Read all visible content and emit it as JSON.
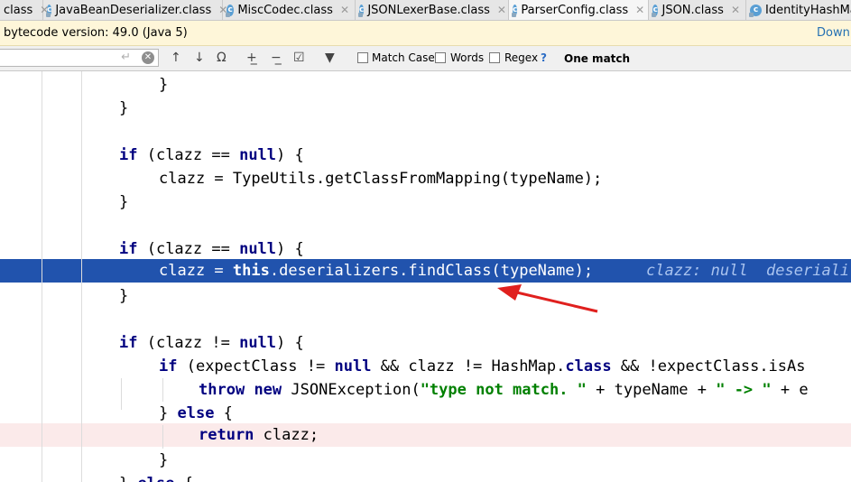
{
  "tabs": [
    {
      "label": "class",
      "active": false,
      "icon": "none"
    },
    {
      "label": "JavaBeanDeserializer.class",
      "active": false,
      "icon": "class-icon"
    },
    {
      "label": "MiscCodec.class",
      "active": false,
      "icon": "class-icon"
    },
    {
      "label": "JSONLexerBase.class",
      "active": false,
      "icon": "class-icon"
    },
    {
      "label": "ParserConfig.class",
      "active": true,
      "icon": "class-icon"
    },
    {
      "label": "JSON.class",
      "active": false,
      "icon": "class-icon"
    },
    {
      "label": "IdentityHashMa",
      "active": false,
      "icon": "class-icon"
    }
  ],
  "infobar": {
    "message": "bytecode version: 49.0 (Java 5)",
    "link": "Downlo"
  },
  "search": {
    "value": "",
    "match_case": "Match Case",
    "words": "Words",
    "regex": "Regex",
    "help": "?",
    "result": "One match"
  },
  "code": {
    "l1": "}",
    "l2": "}",
    "l4_kw": "if",
    "l4_a": " (clazz == ",
    "l4_null": "null",
    "l4_b": ") {",
    "l5": "clazz = TypeUtils.getClassFromMapping(typeName);",
    "l6": "}",
    "l8_kw": "if",
    "l8_a": " (clazz == ",
    "l8_null": "null",
    "l8_b": ") {",
    "l9_a": "clazz = ",
    "l9_this": "this",
    "l9_b": ".",
    "l9_fld": "deserializers",
    "l9_c": ".findClass(typeName);",
    "l9_hint": "clazz: null  deseriali",
    "l10": "}",
    "l12_kw": "if",
    "l12_a": " (clazz != ",
    "l12_null": "null",
    "l12_b": ") {",
    "l13_kw": "if",
    "l13_a": " (expectClass != ",
    "l13_null": "null",
    "l13_b": " && clazz != HashMap.",
    "l13_class": "class",
    "l13_c": " && !expectClass.isAs",
    "l14_throw": "throw",
    "l14_new": "new",
    "l14_a": " JSONException(",
    "l14_str": "\"type not match. \"",
    "l14_b": " + typeName + ",
    "l14_str2": "\" -> \"",
    "l14_c": " + e",
    "l15_a": "} ",
    "l15_else": "else",
    "l15_b": " {",
    "l16_ret": "return",
    "l16_a": " clazz;",
    "l17": "}",
    "l18_a": "} ",
    "l18_else": "else",
    "l18_b": " {"
  },
  "colors": {
    "highlight": "#2153ad",
    "keyword": "#000080",
    "string": "#008000",
    "arrow": "#e0201e"
  }
}
